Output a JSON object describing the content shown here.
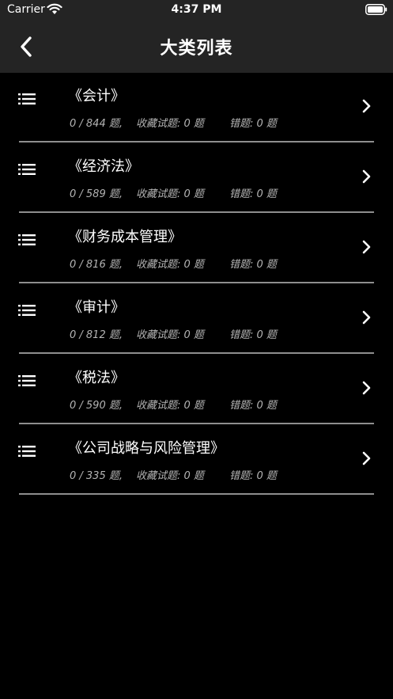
{
  "status_bar": {
    "carrier": "Carrier",
    "time": "4:37 PM"
  },
  "nav": {
    "title": "大类列表"
  },
  "categories": [
    {
      "title": "《会计》",
      "progress": "0 / 844 题,",
      "favorites": "收藏试题: 0 题",
      "errors": "错题: 0 题"
    },
    {
      "title": "《经济法》",
      "progress": "0 / 589 题,",
      "favorites": "收藏试题: 0 题",
      "errors": "错题: 0 题"
    },
    {
      "title": "《财务成本管理》",
      "progress": "0 / 816 题,",
      "favorites": "收藏试题: 0 题",
      "errors": "错题: 0 题"
    },
    {
      "title": "《审计》",
      "progress": "0 / 812 题,",
      "favorites": "收藏试题: 0 题",
      "errors": "错题: 0 题"
    },
    {
      "title": "《税法》",
      "progress": "0 / 590 题,",
      "favorites": "收藏试题: 0 题",
      "errors": "错题: 0 题"
    },
    {
      "title": "《公司战略与风险管理》",
      "progress": "0 / 335 题,",
      "favorites": "收藏试题: 0 题",
      "errors": "错题: 0 题"
    }
  ],
  "icons": {
    "row": "list-icon",
    "chevron": "chevron-right-icon",
    "back": "chevron-left-icon"
  },
  "colors": {
    "background": "#000000",
    "bar": "#242424",
    "divider": "#8e8e8e",
    "secondary_text": "#b4b4b4"
  }
}
